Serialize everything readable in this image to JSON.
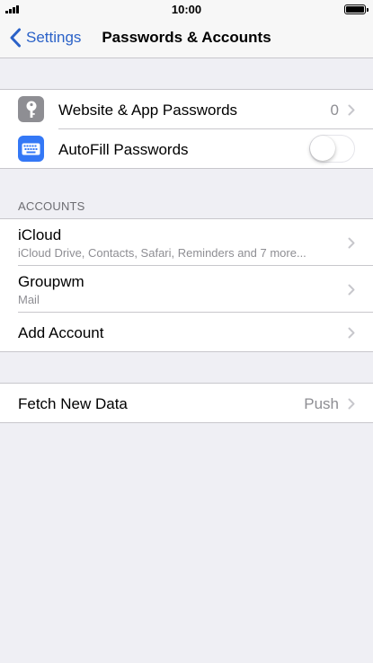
{
  "status_bar": {
    "time": "10:00"
  },
  "nav": {
    "back_label": "Settings",
    "title": "Passwords & Accounts"
  },
  "passwords_group": {
    "website_app_passwords": {
      "label": "Website & App Passwords",
      "count": "0",
      "icon": "key-icon"
    },
    "autofill_passwords": {
      "label": "AutoFill Passwords",
      "enabled": false,
      "icon": "keyboard-icon"
    }
  },
  "accounts": {
    "header": "ACCOUNTS",
    "items": [
      {
        "title": "iCloud",
        "subtitle": "iCloud Drive, Contacts, Safari, Reminders and 7 more..."
      },
      {
        "title": "Groupwm",
        "subtitle": "Mail"
      }
    ],
    "add_account": "Add Account"
  },
  "fetch": {
    "label": "Fetch New Data",
    "value": "Push"
  },
  "colors": {
    "accent": "#2b62c8",
    "key_icon_bg": "#8e8e93",
    "keyboard_icon_bg": "#3478f6",
    "background": "#efeff4"
  }
}
